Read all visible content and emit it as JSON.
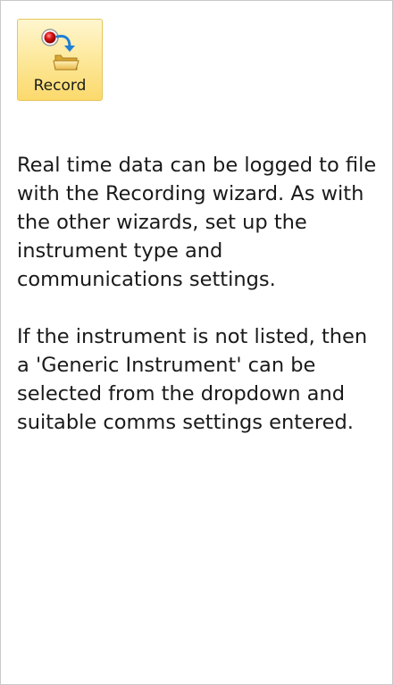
{
  "toolbar": {
    "record_label": "Record",
    "record_icon": "record-to-folder-icon"
  },
  "help": {
    "paragraph1": "Real time data can be logged to file with the Recording wizard. As with the other wizards, set up the instrument type and communications settings.",
    "paragraph2": "If the instrument is not listed, then a 'Generic Instrument' can be selected from the dropdown and suitable comms settings entered."
  }
}
